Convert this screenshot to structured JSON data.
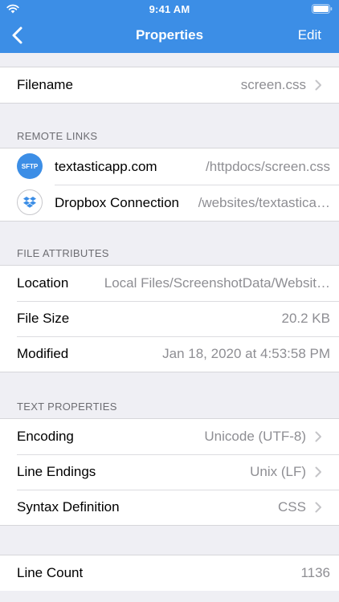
{
  "status_bar": {
    "time": "9:41 AM"
  },
  "nav": {
    "title": "Properties",
    "edit_label": "Edit"
  },
  "filename_row": {
    "label": "Filename",
    "value": "screen.css"
  },
  "remote_links": {
    "header": "REMOTE LINKS",
    "items": [
      {
        "icon": "sftp-icon",
        "icon_text": "SFTP",
        "name": "textasticapp.com",
        "path": "/httpdocs/screen.css"
      },
      {
        "icon": "dropbox-icon",
        "name": "Dropbox Connection",
        "path": "/websites/textastica…"
      }
    ]
  },
  "file_attributes": {
    "header": "FILE ATTRIBUTES",
    "rows": [
      {
        "label": "Location",
        "value": "Local Files/ScreenshotData/Websit…"
      },
      {
        "label": "File Size",
        "value": "20.2 KB"
      },
      {
        "label": "Modified",
        "value": "Jan 18, 2020 at 4:53:58 PM"
      }
    ]
  },
  "text_properties": {
    "header": "TEXT PROPERTIES",
    "rows": [
      {
        "label": "Encoding",
        "value": "Unicode (UTF-8)"
      },
      {
        "label": "Line Endings",
        "value": "Unix (LF)"
      },
      {
        "label": "Syntax Definition",
        "value": "CSS"
      }
    ]
  },
  "counts": {
    "rows": [
      {
        "label": "Line Count",
        "value": "1136"
      }
    ]
  },
  "colors": {
    "accent": "#3c8ee6",
    "background": "#efeff4",
    "secondary_text": "#8e8e93"
  }
}
